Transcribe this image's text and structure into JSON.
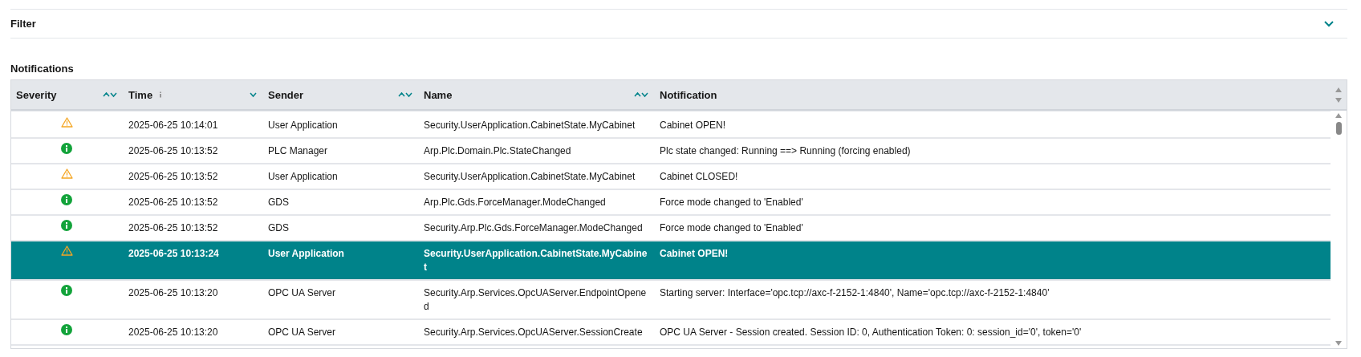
{
  "filter": {
    "title": "Filter",
    "expanded": false
  },
  "notifications": {
    "title": "Notifications",
    "columns": [
      {
        "label": "Severity",
        "sortable": true,
        "sorted": false,
        "info": false
      },
      {
        "label": "Time",
        "sortable": true,
        "sorted": true,
        "info": true
      },
      {
        "label": "Sender",
        "sortable": true,
        "sorted": false,
        "info": false
      },
      {
        "label": "Name",
        "sortable": true,
        "sorted": false,
        "info": false
      },
      {
        "label": "Notification",
        "sortable": false,
        "info": false
      }
    ],
    "rows": [
      {
        "kind": "warning",
        "time": "2025-06-25 10:14:01",
        "sender": "User Application",
        "name": "Security.UserApplication.CabinetState.MyCabinet",
        "notification": "Cabinet OPEN!",
        "selected": false
      },
      {
        "kind": "info",
        "time": "2025-06-25 10:13:52",
        "sender": "PLC Manager",
        "name": "Arp.Plc.Domain.Plc.StateChanged",
        "notification": "Plc state changed: Running ==> Running (forcing enabled)",
        "selected": false
      },
      {
        "kind": "warning",
        "time": "2025-06-25 10:13:52",
        "sender": "User Application",
        "name": "Security.UserApplication.CabinetState.MyCabinet",
        "notification": "Cabinet CLOSED!",
        "selected": false
      },
      {
        "kind": "info",
        "time": "2025-06-25 10:13:52",
        "sender": "GDS",
        "name": "Arp.Plc.Gds.ForceManager.ModeChanged",
        "notification": "Force mode changed to 'Enabled'",
        "selected": false
      },
      {
        "kind": "info",
        "time": "2025-06-25 10:13:52",
        "sender": "GDS",
        "name": "Security.Arp.Plc.Gds.ForceManager.ModeChanged",
        "notification": "Force mode changed to 'Enabled'",
        "selected": false
      },
      {
        "kind": "warning",
        "time": "2025-06-25 10:13:24",
        "sender": "User Application",
        "name": "Security.UserApplication.CabinetState.MyCabinet",
        "notification": "Cabinet OPEN!",
        "selected": true
      },
      {
        "kind": "info",
        "time": "2025-06-25 10:13:20",
        "sender": "OPC UA Server",
        "name": "Security.Arp.Services.OpcUAServer.EndpointOpened",
        "notification": "Starting server: Interface='opc.tcp://axc-f-2152-1:4840', Name='opc.tcp://axc-f-2152-1:4840'",
        "selected": false
      },
      {
        "kind": "info",
        "time": "2025-06-25 10:13:20",
        "sender": "OPC UA Server",
        "name": "Security.Arp.Services.OpcUAServer.SessionCreate",
        "notification": "OPC UA Server - Session created. Session ID: 0, Authentication Token: 0: session_id='0', token='0'",
        "selected": false
      }
    ]
  }
}
